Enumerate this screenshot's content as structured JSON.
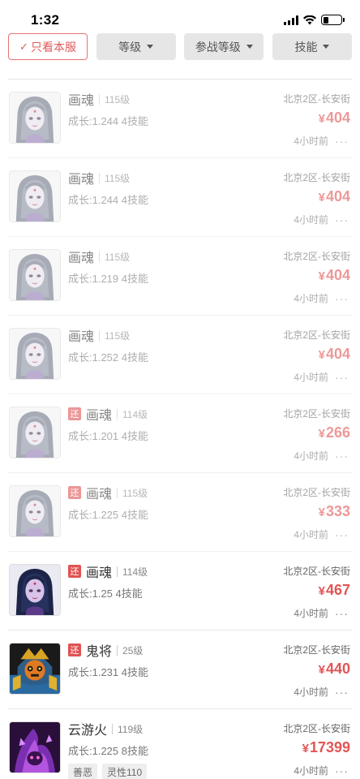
{
  "status_bar": {
    "time": "1:32"
  },
  "filters": {
    "only_label": "只看本服",
    "level_label": "等级",
    "battle_level_label": "参战等级",
    "skill_label": "技能"
  },
  "items": [
    {
      "name": "画魂",
      "level": "115级",
      "attrs": "成长:1.244 4技能",
      "server": "北京2区-长安街",
      "price": "404",
      "time": "4小时前",
      "returned": false,
      "faded": true,
      "avatar": "huahun",
      "tags": []
    },
    {
      "name": "画魂",
      "level": "115级",
      "attrs": "成长:1.244 4技能",
      "server": "北京2区-长安街",
      "price": "404",
      "time": "4小时前",
      "returned": false,
      "faded": true,
      "avatar": "huahun",
      "tags": []
    },
    {
      "name": "画魂",
      "level": "115级",
      "attrs": "成长:1.219 4技能",
      "server": "北京2区-长安街",
      "price": "404",
      "time": "4小时前",
      "returned": false,
      "faded": true,
      "avatar": "huahun",
      "tags": []
    },
    {
      "name": "画魂",
      "level": "115级",
      "attrs": "成长:1.252 4技能",
      "server": "北京2区-长安街",
      "price": "404",
      "time": "4小时前",
      "returned": false,
      "faded": true,
      "avatar": "huahun",
      "tags": []
    },
    {
      "name": "画魂",
      "level": "114级",
      "attrs": "成长:1.201 4技能",
      "server": "北京2区-长安街",
      "price": "266",
      "time": "4小时前",
      "returned": true,
      "return_label": "还",
      "faded": true,
      "avatar": "huahun",
      "tags": []
    },
    {
      "name": "画魂",
      "level": "115级",
      "attrs": "成长:1.225 4技能",
      "server": "北京2区-长安街",
      "price": "333",
      "time": "4小时前",
      "returned": true,
      "return_label": "还",
      "faded": true,
      "avatar": "huahun",
      "tags": []
    },
    {
      "name": "画魂",
      "level": "114级",
      "attrs": "成长:1.25 4技能",
      "server": "北京2区-长安街",
      "price": "467",
      "time": "4小时前",
      "returned": true,
      "return_label": "还",
      "faded": false,
      "avatar": "huahun-dark",
      "tags": []
    },
    {
      "name": "鬼将",
      "level": "25级",
      "attrs": "成长:1.231 4技能",
      "server": "北京2区-长安街",
      "price": "440",
      "time": "4小时前",
      "returned": true,
      "return_label": "还",
      "faded": false,
      "avatar": "guijiang",
      "tags": []
    },
    {
      "name": "云游火",
      "level": "119级",
      "attrs": "成长:1.225 8技能",
      "server": "北京2区-长安街",
      "price": "17399",
      "time": "4小时前",
      "returned": false,
      "faded": false,
      "avatar": "yunyouhuo",
      "tags": [
        "善恶",
        "灵性110"
      ]
    }
  ],
  "currency_symbol": "¥",
  "more_glyph": "···",
  "colors": {
    "accent": "#e25555",
    "tag_bg": "#eeeeee",
    "filter_bg": "#e6e6e6"
  }
}
